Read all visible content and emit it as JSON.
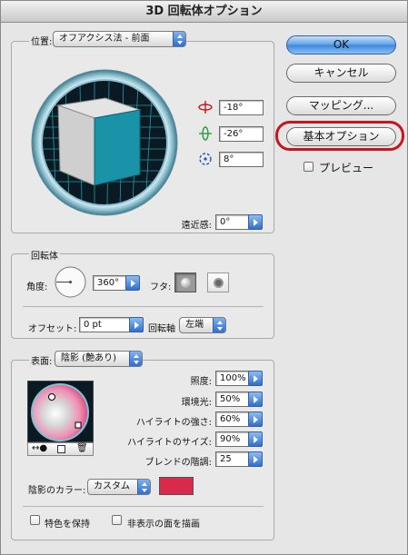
{
  "window": {
    "title": "3D 回転体オプション"
  },
  "position": {
    "label": "位置:",
    "preset": "オフアクシス法 - 前面",
    "x_angle": "-18°",
    "y_angle": "-26°",
    "z_angle": "8°",
    "perspective_label": "遠近感:",
    "perspective": "0°"
  },
  "buttons": {
    "ok": "OK",
    "cancel": "キャンセル",
    "mapping": "マッピング...",
    "basic": "基本オプション",
    "preview": "プレビュー"
  },
  "revolve": {
    "title": "回転体",
    "angle_label": "角度:",
    "angle": "360°",
    "cap_label": "フタ:",
    "offset_label": "オフセット:",
    "offset": "0 pt",
    "axis_label": "回転軸",
    "axis": "左端"
  },
  "surface": {
    "label": "表面:",
    "type": "陰影 (艶あり)",
    "intensity_label": "照度:",
    "intensity": "100%",
    "ambient_label": "環境光:",
    "ambient": "50%",
    "highlight_intensity_label": "ハイライトの強さ:",
    "highlight_intensity": "60%",
    "highlight_size_label": "ハイライトのサイズ:",
    "highlight_size": "90%",
    "blend_steps_label": "ブレンドの階調:",
    "blend_steps": "25",
    "shading_color_label": "陰影のカラー:",
    "shading_color": "カスタム",
    "swatch_color": "#d82a4a",
    "preserve_spot": "特色を保持",
    "draw_hidden": "非表示の面を描画"
  },
  "colors": {
    "accent": "#3b82d8",
    "highlight_ring": "#c4161c",
    "cube_front": "#1a93a8"
  }
}
